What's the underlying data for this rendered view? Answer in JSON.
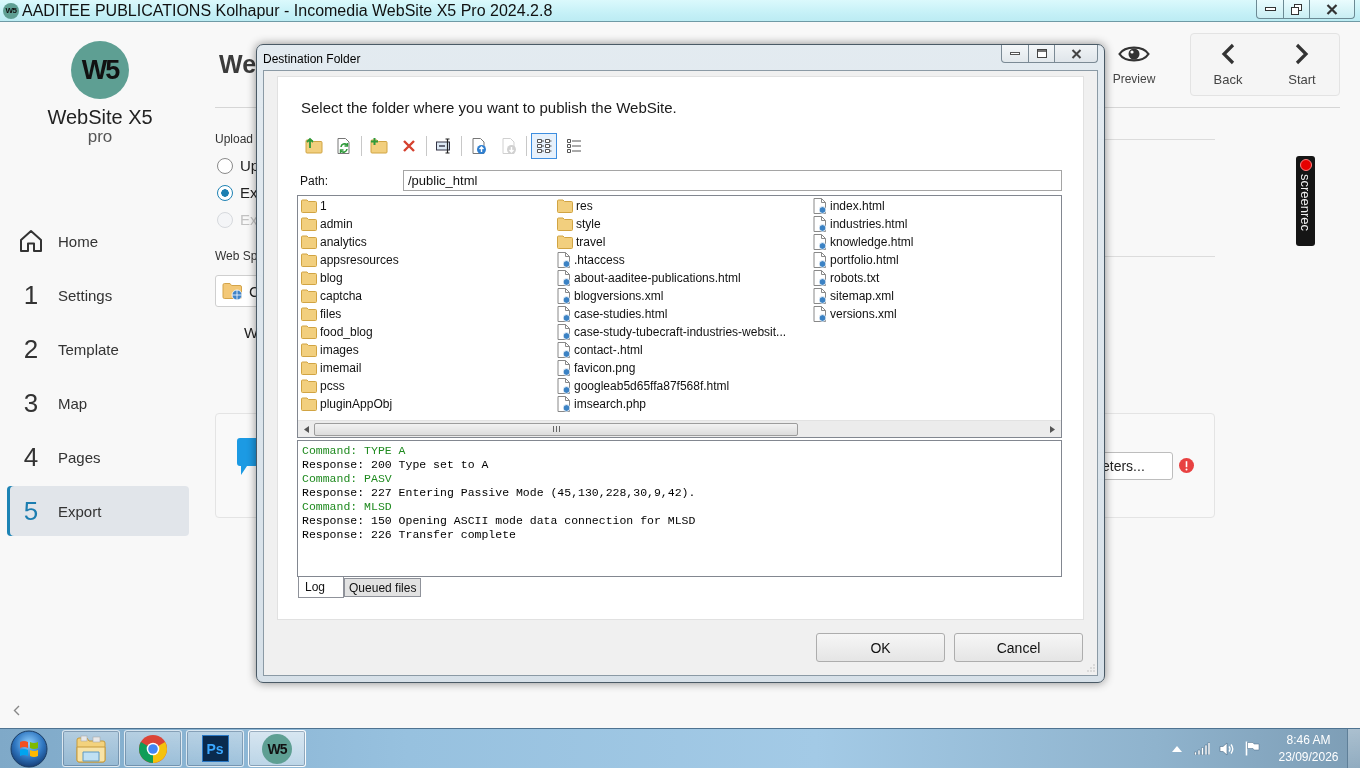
{
  "title_bar": {
    "app_mark": "W5",
    "title": "AADITEE PUBLICATIONS Kolhapur - Incomedia WebSite X5 Pro 2024.2.8"
  },
  "sidebar": {
    "logo": {
      "mark": "W5",
      "name": "WebSite X5",
      "edition": "pro"
    },
    "nav": [
      {
        "kind": "home",
        "label": "Home",
        "selected": false
      },
      {
        "kind": "step",
        "number": "1",
        "label": "Settings",
        "selected": false
      },
      {
        "kind": "step",
        "number": "2",
        "label": "Template",
        "selected": false
      },
      {
        "kind": "step",
        "number": "3",
        "label": "Map",
        "selected": false
      },
      {
        "kind": "step",
        "number": "4",
        "label": "Pages",
        "selected": false
      },
      {
        "kind": "step",
        "number": "5",
        "label": "Export",
        "selected": true
      }
    ]
  },
  "header": {
    "title": "We",
    "preview": {
      "label": "Preview"
    },
    "navigation": [
      {
        "kind": "back",
        "label": "Back"
      },
      {
        "kind": "start",
        "label": "Start"
      }
    ]
  },
  "main": {
    "upload_section": {
      "label": "Upload",
      "options": [
        {
          "label": "Up",
          "selected": false,
          "disabled": false
        },
        {
          "label": "Ex",
          "selected": true,
          "disabled": false
        },
        {
          "label": "Ex",
          "selected": false,
          "disabled": true
        }
      ]
    },
    "web_space_section": {
      "label": "Web Sp",
      "folder_button": "C",
      "partial_label": "W"
    },
    "card": {
      "button": "eters...",
      "error": true
    }
  },
  "screen_recorder": {
    "label": "screenrec"
  },
  "dialog": {
    "title": "Destination Folder",
    "instruction": "Select the folder where you want to publish the WebSite.",
    "toolbar": [
      {
        "buttons": [
          {
            "kind": "up",
            "selected": false,
            "disabled": false
          },
          {
            "kind": "refresh",
            "selected": false,
            "disabled": false
          }
        ]
      },
      {
        "buttons": [
          {
            "kind": "newfolder",
            "selected": false,
            "disabled": false
          },
          {
            "kind": "delete",
            "selected": false,
            "disabled": false
          }
        ]
      },
      {
        "buttons": [
          {
            "kind": "rename",
            "selected": false,
            "disabled": false
          }
        ]
      },
      {
        "buttons": [
          {
            "kind": "upload",
            "selected": false,
            "disabled": false
          },
          {
            "kind": "download",
            "selected": false,
            "disabled": true
          }
        ]
      },
      {
        "buttons": [
          {
            "kind": "columns",
            "selected": true,
            "disabled": false
          },
          {
            "kind": "details",
            "selected": false,
            "disabled": false
          }
        ]
      }
    ],
    "path": {
      "label": "Path:",
      "value": "/public_html"
    },
    "files": [
      {
        "kind": "folder",
        "name": "1"
      },
      {
        "kind": "folder",
        "name": "admin"
      },
      {
        "kind": "folder",
        "name": "analytics"
      },
      {
        "kind": "folder",
        "name": "appsresources"
      },
      {
        "kind": "folder",
        "name": "blog"
      },
      {
        "kind": "folder",
        "name": "captcha"
      },
      {
        "kind": "folder",
        "name": "files"
      },
      {
        "kind": "folder",
        "name": "food_blog"
      },
      {
        "kind": "folder",
        "name": "images"
      },
      {
        "kind": "folder",
        "name": "imemail"
      },
      {
        "kind": "folder",
        "name": "pcss"
      },
      {
        "kind": "folder",
        "name": "pluginAppObj"
      },
      {
        "kind": "folder",
        "name": "res"
      },
      {
        "kind": "folder",
        "name": "style"
      },
      {
        "kind": "folder",
        "name": "travel"
      },
      {
        "kind": "file",
        "name": ".htaccess"
      },
      {
        "kind": "file",
        "name": "about-aaditee-publications.html"
      },
      {
        "kind": "file",
        "name": "blogversions.xml"
      },
      {
        "kind": "file",
        "name": "case-studies.html"
      },
      {
        "kind": "file",
        "name": "case-study-tubecraft-industries-websit..."
      },
      {
        "kind": "file",
        "name": "contact-.html"
      },
      {
        "kind": "file",
        "name": "favicon.png"
      },
      {
        "kind": "file",
        "name": "googleab5d65ffa87f568f.html"
      },
      {
        "kind": "file",
        "name": "imsearch.php"
      },
      {
        "kind": "file",
        "name": "index.html"
      },
      {
        "kind": "file",
        "name": "industries.html"
      },
      {
        "kind": "file",
        "name": "knowledge.html"
      },
      {
        "kind": "file",
        "name": "portfolio.html"
      },
      {
        "kind": "file",
        "name": "robots.txt"
      },
      {
        "kind": "file",
        "name": "sitemap.xml"
      },
      {
        "kind": "file",
        "name": "versions.xml"
      }
    ],
    "log": [
      {
        "kind": "command",
        "text": "Command: TYPE A"
      },
      {
        "kind": "response",
        "text": "Response: 200 Type set to A"
      },
      {
        "kind": "command",
        "text": "Command: PASV"
      },
      {
        "kind": "response",
        "text": "Response: 227 Entering Passive Mode (45,130,228,30,9,42)."
      },
      {
        "kind": "command",
        "text": "Command: MLSD"
      },
      {
        "kind": "response",
        "text": "Response: 150 Opening ASCII mode data connection for MLSD"
      },
      {
        "kind": "response",
        "text": "Response: 226 Transfer complete"
      }
    ],
    "tabs": [
      {
        "label": "Log",
        "selected": true
      },
      {
        "label": "Queued files",
        "selected": false
      }
    ],
    "buttons": [
      {
        "label": "OK"
      },
      {
        "label": "Cancel"
      }
    ]
  },
  "taskbar": {
    "apps": [
      {
        "kind": "explorer",
        "selected": false
      },
      {
        "kind": "browser",
        "selected": false
      },
      {
        "kind": "photoshop",
        "mark": "Ps",
        "selected": false
      },
      {
        "kind": "websitex5",
        "mark": "W5",
        "selected": true
      }
    ],
    "clock": {
      "time": "8:46 AM",
      "date": "23/09/2026"
    }
  }
}
